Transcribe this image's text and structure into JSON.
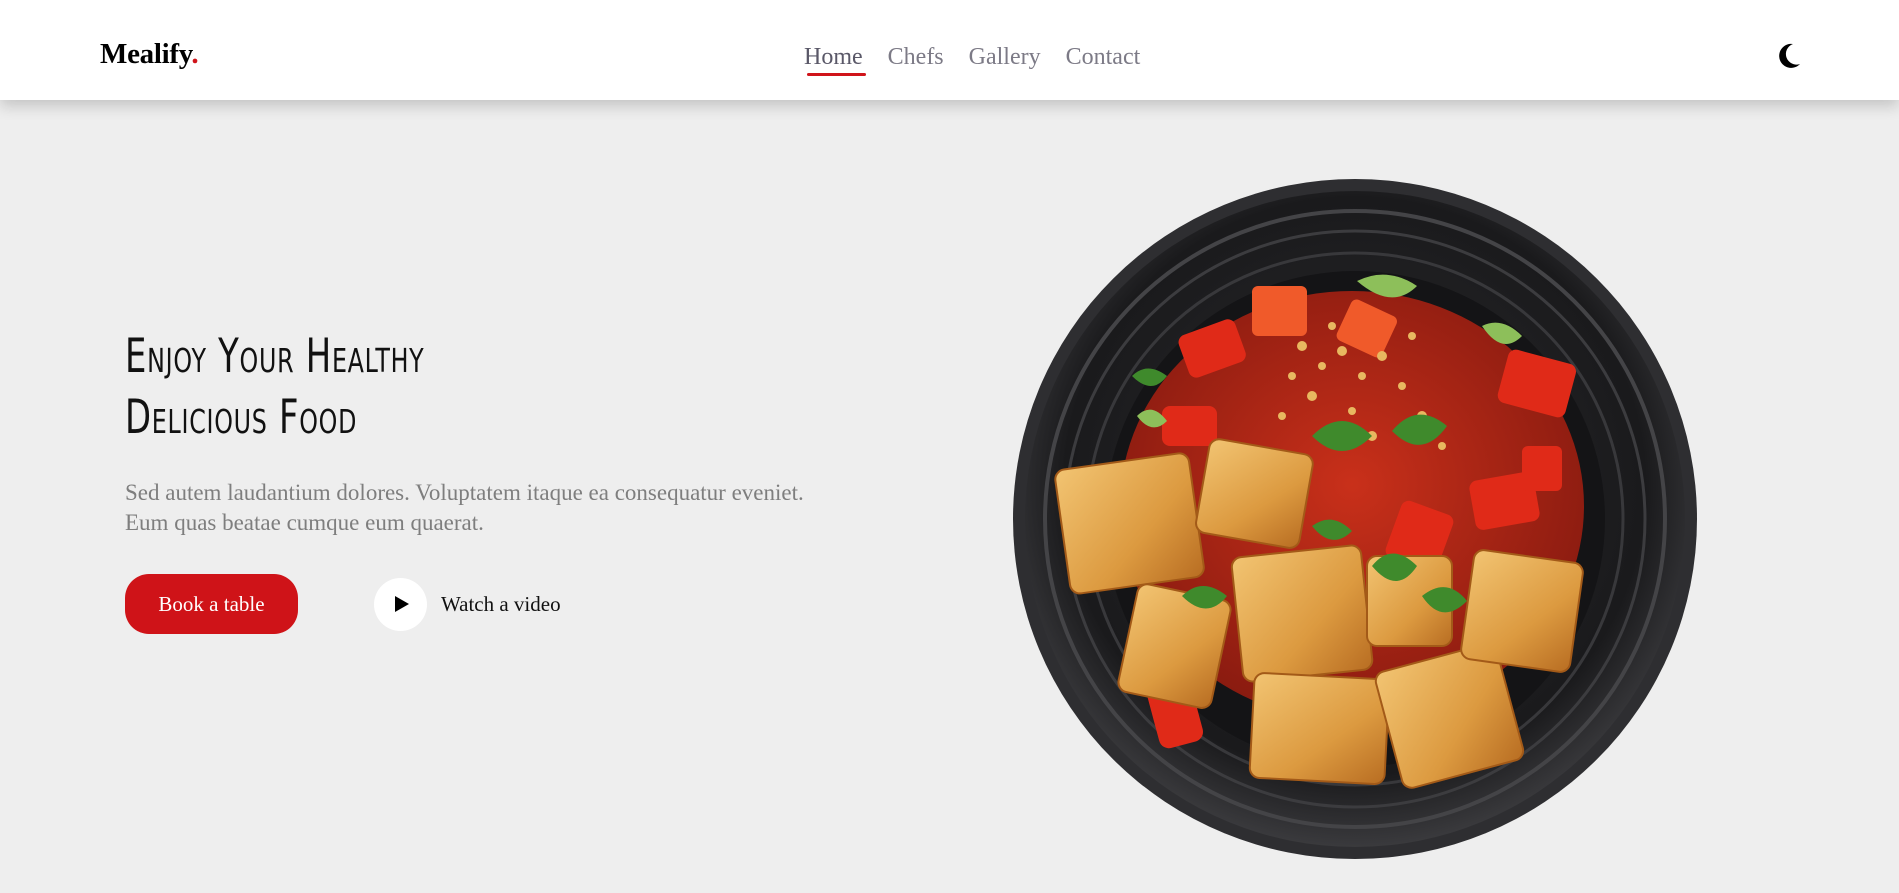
{
  "header": {
    "logo_text": "Mealify",
    "logo_dot": ".",
    "nav": [
      {
        "label": "Home",
        "active": true
      },
      {
        "label": "Chefs",
        "active": false
      },
      {
        "label": "Gallery",
        "active": false
      },
      {
        "label": "Contact",
        "active": false
      }
    ],
    "theme_icon": "moon-icon"
  },
  "hero": {
    "title_line1": "Enjoy Your Healthy",
    "title_line2": "Delicious Food",
    "description": "Sed autem laudantium dolores. Voluptatem itaque ea consequatur eveniet. Eum quas beatae cumque eum quaerat.",
    "book_button": "Book a table",
    "watch_label": "Watch a video",
    "play_icon": "play-icon",
    "image": "food-plate-image"
  },
  "colors": {
    "accent": "#cf1318",
    "background": "#eeeeee",
    "header_bg": "#ffffff",
    "nav_text": "#7c7a86"
  }
}
